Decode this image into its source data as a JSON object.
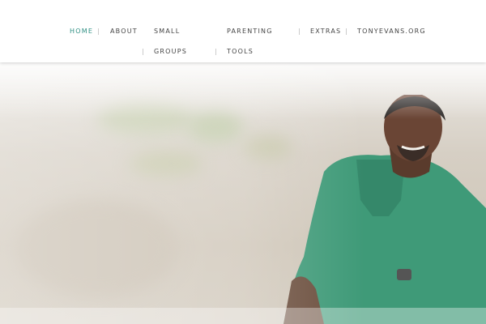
{
  "nav": {
    "home": "Home",
    "about": "About",
    "small_groups_line1": "Small",
    "small_groups_line2": "Groups",
    "parenting_line1": "Parenting",
    "parenting_line2": "Tools",
    "extras": "Extras",
    "tonyevans": "TonyEvans.org",
    "separator": "|"
  },
  "colors": {
    "active_link": "#2f8f83",
    "shirt": "#3f9a78"
  }
}
